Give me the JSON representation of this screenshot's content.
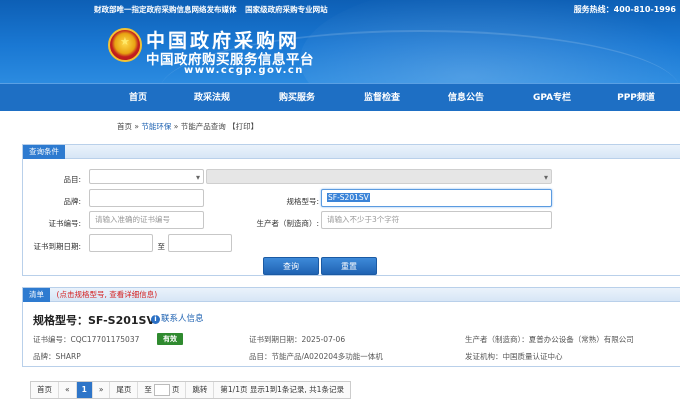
{
  "header": {
    "top_links": [
      "财政部唯一指定政府采购信息网络发布媒体",
      "国家级政府采购专业网站"
    ],
    "hotline": "服务热线：400-810-1996",
    "title": "中国政府采购网",
    "subtitle": "中国政府购买服务信息平台",
    "url": "www.ccgp.gov.cn"
  },
  "nav": [
    "首页",
    "政采法规",
    "购买服务",
    "监督检查",
    "信息公告",
    "GPA专栏",
    "PPP频道"
  ],
  "breadcrumb": {
    "home": "首页",
    "sep1": "»",
    "section": "节能环保",
    "sep2": "»",
    "page": "节能产品查询",
    "print": "【打印】"
  },
  "query": {
    "panel_title": "查询条件",
    "category_label": "品目:",
    "brand_label": "品牌:",
    "model_label": "规格型号:",
    "model_value": "SF-S201SV",
    "cert_no_label": "证书编号:",
    "cert_no_placeholder": "请输入准确的证书编号",
    "producer_label": "生产者（制造商）:",
    "producer_placeholder": "请输入不少于3个字符",
    "expiry_label": "证书到期日期:",
    "to_label": "至",
    "search_button": "查询",
    "reset_button": "重置"
  },
  "results": {
    "panel_title": "清单",
    "hint": "(点击规格型号, 查看详细信息)",
    "item": {
      "title": "规格型号：SF-S201SV",
      "contact": "联系人信息",
      "cert_no": "证书编号：CQC17701175037",
      "status": "有效",
      "expiry": "证书到期日期：2025-07-06",
      "producer": "生产者（制造商）：夏普办公设备（常熟）有限公司",
      "brand": "品牌：SHARP",
      "category": "品目：节能产品/A020204多功能一体机",
      "issuer": "发证机构：中国质量认证中心"
    }
  },
  "pager": {
    "first": "首页",
    "prev": "«",
    "current": "1",
    "next": "»",
    "last": "尾页",
    "goto_prefix": "至",
    "goto_suffix": "页",
    "jump": "跳转",
    "summary": "第1/1页  显示1到1条记录, 共1条记录"
  },
  "colors": {
    "header_blue": "#1a78d3",
    "nav_blue": "#1e6fc4",
    "accent": "#2e7bd0",
    "hint_red": "#d42020",
    "status_green": "#2f8a2f"
  }
}
